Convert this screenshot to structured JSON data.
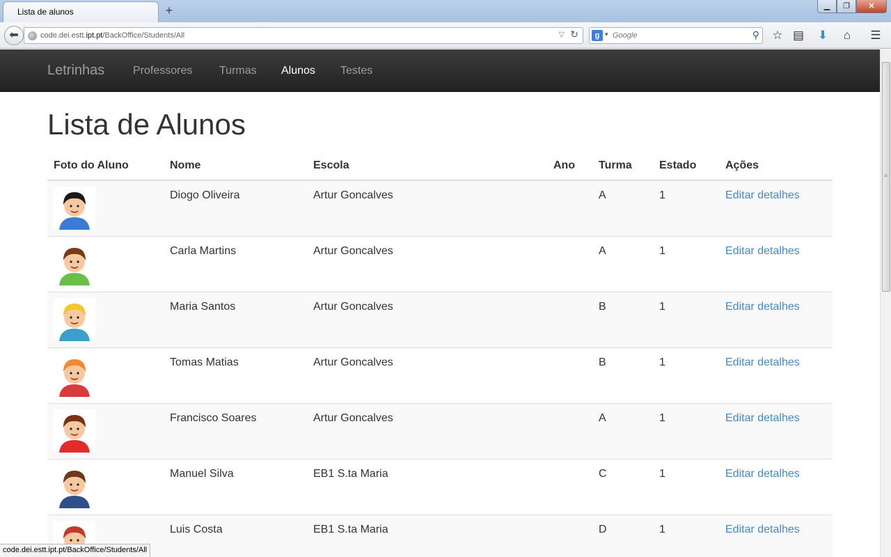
{
  "browser": {
    "tab_title": "Lista de alunos",
    "new_tab_label": "+",
    "url_host_prefix": "code.dei.estt.",
    "url_host_bold": "ipt.pt",
    "url_path": "/BackOffice/Students/All",
    "search_engine_letter": "g",
    "search_placeholder": "Google",
    "status_url": "code.dei.estt.ipt.pt/BackOffice/Students/All",
    "window_buttons": {
      "minimize": "▁",
      "maximize": "❐",
      "close": "✕"
    }
  },
  "nav": {
    "brand": "Letrinhas",
    "links": [
      {
        "label": "Professores",
        "active": false
      },
      {
        "label": "Turmas",
        "active": false
      },
      {
        "label": "Alunos",
        "active": true
      },
      {
        "label": "Testes",
        "active": false
      }
    ]
  },
  "page": {
    "title": "Lista de Alunos",
    "columns": [
      "Foto do Aluno",
      "Nome",
      "Escola",
      "Ano",
      "Turma",
      "Estado",
      "Ações"
    ],
    "students": [
      {
        "name": "Diogo Oliveira",
        "school": "Artur Goncalves",
        "year": "",
        "class": "A",
        "state": "1",
        "action": "Editar detalhes",
        "avatar": "boy-glasses",
        "hair": "#1a1a1a",
        "shirt": "#3a7bd5"
      },
      {
        "name": "Carla Martins",
        "school": "Artur Goncalves",
        "year": "",
        "class": "A",
        "state": "1",
        "action": "Editar detalhes",
        "avatar": "girl-brown",
        "hair": "#7a3b1a",
        "shirt": "#6abf4b"
      },
      {
        "name": "Maria Santos",
        "school": "Artur Goncalves",
        "year": "",
        "class": "B",
        "state": "1",
        "action": "Editar detalhes",
        "avatar": "girl-blonde",
        "hair": "#f2c72e",
        "shirt": "#3aa0c9"
      },
      {
        "name": "Tomas Matias",
        "school": "Artur Goncalves",
        "year": "",
        "class": "B",
        "state": "1",
        "action": "Editar detalhes",
        "avatar": "boy-ginger",
        "hair": "#f08a2c",
        "shirt": "#d93b3b"
      },
      {
        "name": "Francisco Soares",
        "school": "Artur Goncalves",
        "year": "",
        "class": "A",
        "state": "1",
        "action": "Editar detalhes",
        "avatar": "boy-red",
        "hair": "#7a3212",
        "shirt": "#e32b2b"
      },
      {
        "name": "Manuel Silva",
        "school": "EB1 S.ta Maria",
        "year": "",
        "class": "C",
        "state": "1",
        "action": "Editar detalhes",
        "avatar": "boy-suit",
        "hair": "#6b3a1c",
        "shirt": "#2f4f8a"
      },
      {
        "name": "Luis Costa",
        "school": "EB1 S.ta Maria",
        "year": "",
        "class": "D",
        "state": "1",
        "action": "Editar detalhes",
        "avatar": "boy-redhair",
        "hair": "#c0392b",
        "shirt": "#3a7bd5"
      }
    ]
  },
  "colors": {
    "nav_bg": "#222222",
    "nav_text": "#9d9d9d",
    "nav_active": "#ffffff",
    "link": "#428bca",
    "striped_row": "#f9f9f9",
    "text": "#333333"
  }
}
